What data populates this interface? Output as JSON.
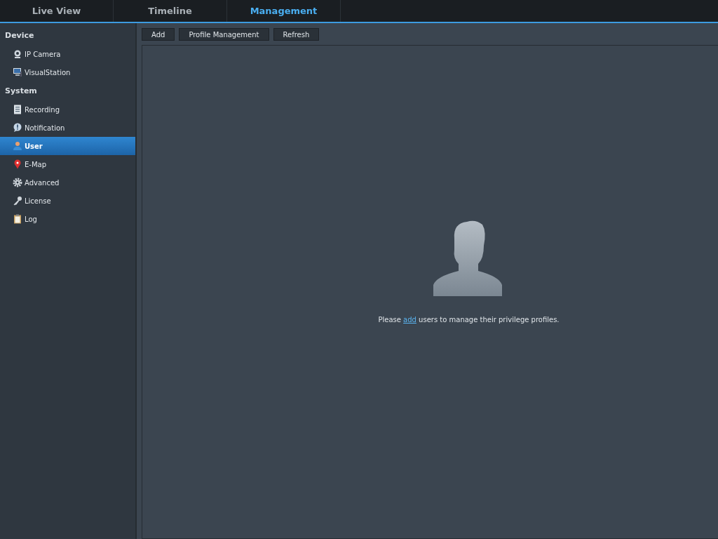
{
  "tabs": [
    {
      "label": "Live View",
      "selected": false
    },
    {
      "label": "Timeline",
      "selected": false
    },
    {
      "label": "Management",
      "selected": true
    }
  ],
  "sidebar": {
    "sections": [
      {
        "title": "Device",
        "items": [
          {
            "label": "IP Camera",
            "kind": "camera",
            "selected": false
          },
          {
            "label": "VisualStation",
            "kind": "monitor",
            "selected": false
          }
        ]
      },
      {
        "title": "System",
        "items": [
          {
            "label": "Recording",
            "kind": "list",
            "selected": false
          },
          {
            "label": "Notification",
            "kind": "bubble",
            "selected": false
          },
          {
            "label": "User",
            "kind": "user",
            "selected": true
          },
          {
            "label": "E-Map",
            "kind": "pin",
            "selected": false
          },
          {
            "label": "Advanced",
            "kind": "gear",
            "selected": false
          },
          {
            "label": "License",
            "kind": "key",
            "selected": false
          },
          {
            "label": "Log",
            "kind": "clipboard",
            "selected": false
          }
        ]
      }
    ]
  },
  "toolbar": {
    "buttons": [
      "Add",
      "Profile Management",
      "Refresh"
    ]
  },
  "empty_state": {
    "before": "Please ",
    "link": "add",
    "after": " users to manage their privilege profiles."
  }
}
